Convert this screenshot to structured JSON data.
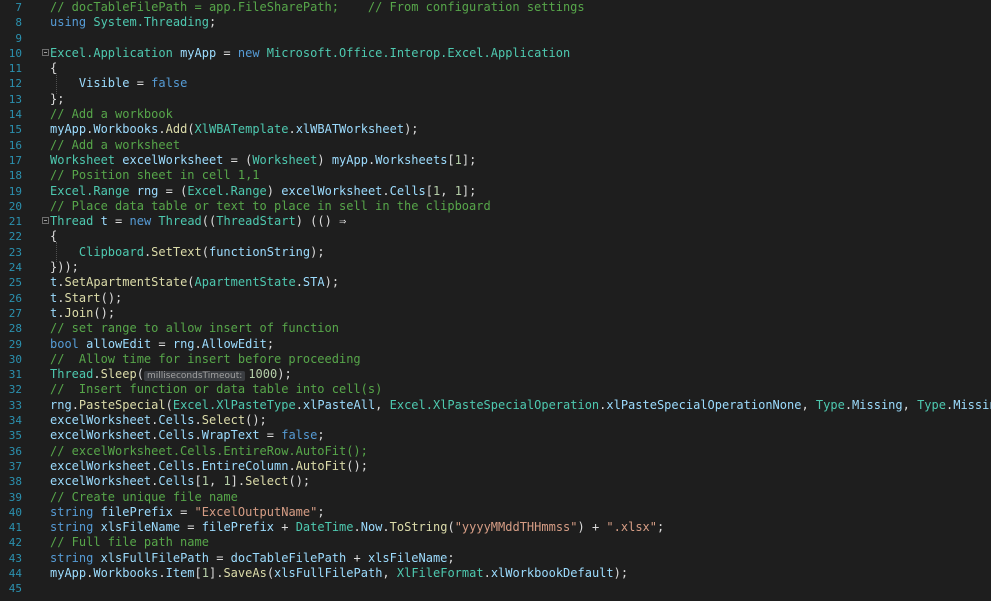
{
  "editor": {
    "lines": [
      {
        "n": "7",
        "tokens": [
          {
            "c": "cm",
            "t": "// docTableFilePath = app.FileSharePath;    // From configuration settings"
          }
        ]
      },
      {
        "n": "8",
        "tokens": [
          {
            "c": "kw",
            "t": "using "
          },
          {
            "c": "ty",
            "t": "System.Threading"
          },
          {
            "c": "",
            "t": ";"
          }
        ]
      },
      {
        "n": "9",
        "tokens": []
      },
      {
        "n": "10",
        "fold": true,
        "tokens": [
          {
            "c": "ty",
            "t": "Excel.Application"
          },
          {
            "c": "",
            "t": " "
          },
          {
            "c": "id",
            "t": "myApp"
          },
          {
            "c": "",
            "t": " = "
          },
          {
            "c": "kw",
            "t": "new "
          },
          {
            "c": "ty",
            "t": "Microsoft.Office.Interop.Excel.Application"
          }
        ]
      },
      {
        "n": "11",
        "tokens": [
          {
            "c": "",
            "t": "{"
          }
        ]
      },
      {
        "n": "12",
        "tokens": [
          {
            "c": "",
            "t": "    "
          },
          {
            "c": "id",
            "t": "Visible"
          },
          {
            "c": "",
            "t": " = "
          },
          {
            "c": "kw",
            "t": "false"
          }
        ]
      },
      {
        "n": "13",
        "tokens": [
          {
            "c": "",
            "t": "};"
          }
        ]
      },
      {
        "n": "14",
        "tokens": [
          {
            "c": "cm",
            "t": "// Add a workbook"
          }
        ]
      },
      {
        "n": "15",
        "tokens": [
          {
            "c": "id",
            "t": "myApp"
          },
          {
            "c": "",
            "t": "."
          },
          {
            "c": "id",
            "t": "Workbooks"
          },
          {
            "c": "",
            "t": "."
          },
          {
            "c": "fn",
            "t": "Add"
          },
          {
            "c": "",
            "t": "("
          },
          {
            "c": "ty",
            "t": "XlWBATemplate"
          },
          {
            "c": "",
            "t": "."
          },
          {
            "c": "id",
            "t": "xlWBATWorksheet"
          },
          {
            "c": "",
            "t": ");"
          }
        ]
      },
      {
        "n": "16",
        "tokens": [
          {
            "c": "cm",
            "t": "// Add a worksheet"
          }
        ]
      },
      {
        "n": "17",
        "tokens": [
          {
            "c": "ty",
            "t": "Worksheet"
          },
          {
            "c": "",
            "t": " "
          },
          {
            "c": "id",
            "t": "excelWorksheet"
          },
          {
            "c": "",
            "t": " = ("
          },
          {
            "c": "ty",
            "t": "Worksheet"
          },
          {
            "c": "",
            "t": ") "
          },
          {
            "c": "id",
            "t": "myApp"
          },
          {
            "c": "",
            "t": "."
          },
          {
            "c": "id",
            "t": "Worksheets"
          },
          {
            "c": "",
            "t": "["
          },
          {
            "c": "nm",
            "t": "1"
          },
          {
            "c": "",
            "t": "];"
          }
        ]
      },
      {
        "n": "18",
        "tokens": [
          {
            "c": "cm",
            "t": "// Position sheet in cell 1,1"
          }
        ]
      },
      {
        "n": "19",
        "tokens": [
          {
            "c": "ty",
            "t": "Excel.Range"
          },
          {
            "c": "",
            "t": " "
          },
          {
            "c": "id",
            "t": "rng"
          },
          {
            "c": "",
            "t": " = ("
          },
          {
            "c": "ty",
            "t": "Excel.Range"
          },
          {
            "c": "",
            "t": ") "
          },
          {
            "c": "id",
            "t": "excelWorksheet"
          },
          {
            "c": "",
            "t": "."
          },
          {
            "c": "id",
            "t": "Cells"
          },
          {
            "c": "",
            "t": "["
          },
          {
            "c": "nm",
            "t": "1"
          },
          {
            "c": "",
            "t": ", "
          },
          {
            "c": "nm",
            "t": "1"
          },
          {
            "c": "",
            "t": "];"
          }
        ]
      },
      {
        "n": "20",
        "tokens": [
          {
            "c": "cm",
            "t": "// Place data table or text to place in sell in the clipboard"
          }
        ]
      },
      {
        "n": "21",
        "fold": true,
        "tokens": [
          {
            "c": "ty",
            "t": "Thread"
          },
          {
            "c": "",
            "t": " "
          },
          {
            "c": "id",
            "t": "t"
          },
          {
            "c": "",
            "t": " = "
          },
          {
            "c": "kw",
            "t": "new "
          },
          {
            "c": "ty",
            "t": "Thread"
          },
          {
            "c": "",
            "t": "(("
          },
          {
            "c": "ty",
            "t": "ThreadStart"
          },
          {
            "c": "",
            "t": ") (() ⇒"
          }
        ]
      },
      {
        "n": "22",
        "tokens": [
          {
            "c": "",
            "t": "{"
          }
        ]
      },
      {
        "n": "23",
        "tokens": [
          {
            "c": "",
            "t": "    "
          },
          {
            "c": "ty",
            "t": "Clipboard"
          },
          {
            "c": "",
            "t": "."
          },
          {
            "c": "fn",
            "t": "SetText"
          },
          {
            "c": "",
            "t": "("
          },
          {
            "c": "id",
            "t": "functionString"
          },
          {
            "c": "",
            "t": ");"
          }
        ]
      },
      {
        "n": "24",
        "tokens": [
          {
            "c": "",
            "t": "}));"
          }
        ]
      },
      {
        "n": "25",
        "tokens": [
          {
            "c": "id",
            "t": "t"
          },
          {
            "c": "",
            "t": "."
          },
          {
            "c": "fn",
            "t": "SetApartmentState"
          },
          {
            "c": "",
            "t": "("
          },
          {
            "c": "ty",
            "t": "ApartmentState"
          },
          {
            "c": "",
            "t": "."
          },
          {
            "c": "id",
            "t": "STA"
          },
          {
            "c": "",
            "t": ");"
          }
        ]
      },
      {
        "n": "26",
        "tokens": [
          {
            "c": "id",
            "t": "t"
          },
          {
            "c": "",
            "t": "."
          },
          {
            "c": "fn",
            "t": "Start"
          },
          {
            "c": "",
            "t": "();"
          }
        ]
      },
      {
        "n": "27",
        "tokens": [
          {
            "c": "id",
            "t": "t"
          },
          {
            "c": "",
            "t": "."
          },
          {
            "c": "fn",
            "t": "Join"
          },
          {
            "c": "",
            "t": "();"
          }
        ]
      },
      {
        "n": "28",
        "tokens": [
          {
            "c": "cm",
            "t": "// set range to allow insert of function"
          }
        ]
      },
      {
        "n": "29",
        "tokens": [
          {
            "c": "kw",
            "t": "bool"
          },
          {
            "c": "",
            "t": " "
          },
          {
            "c": "id",
            "t": "allowEdit"
          },
          {
            "c": "",
            "t": " = "
          },
          {
            "c": "id",
            "t": "rng"
          },
          {
            "c": "",
            "t": "."
          },
          {
            "c": "id",
            "t": "AllowEdit"
          },
          {
            "c": "",
            "t": ";"
          }
        ]
      },
      {
        "n": "30",
        "tokens": [
          {
            "c": "cm",
            "t": "//  Allow time for insert before proceeding"
          }
        ]
      },
      {
        "n": "31",
        "tokens": [
          {
            "c": "ty",
            "t": "Thread"
          },
          {
            "c": "",
            "t": "."
          },
          {
            "c": "fn",
            "t": "Sleep"
          },
          {
            "c": "",
            "t": "("
          },
          {
            "c": "hint",
            "t": "millisecondsTimeout:"
          },
          {
            "c": "nm",
            "t": "1000"
          },
          {
            "c": "",
            "t": ");"
          }
        ]
      },
      {
        "n": "32",
        "tokens": [
          {
            "c": "cm",
            "t": "//  Insert function or data table into cell(s)"
          }
        ]
      },
      {
        "n": "33",
        "tokens": [
          {
            "c": "id",
            "t": "rng"
          },
          {
            "c": "",
            "t": "."
          },
          {
            "c": "fn",
            "t": "PasteSpecial"
          },
          {
            "c": "",
            "t": "("
          },
          {
            "c": "ty",
            "t": "Excel.XlPasteType"
          },
          {
            "c": "",
            "t": "."
          },
          {
            "c": "id",
            "t": "xlPasteAll"
          },
          {
            "c": "",
            "t": ", "
          },
          {
            "c": "ty",
            "t": "Excel.XlPasteSpecialOperation"
          },
          {
            "c": "",
            "t": "."
          },
          {
            "c": "id",
            "t": "xlPasteSpecialOperationNone"
          },
          {
            "c": "",
            "t": ", "
          },
          {
            "c": "ty",
            "t": "Type"
          },
          {
            "c": "",
            "t": "."
          },
          {
            "c": "id",
            "t": "Missing"
          },
          {
            "c": "",
            "t": ", "
          },
          {
            "c": "ty",
            "t": "Type"
          },
          {
            "c": "",
            "t": "."
          },
          {
            "c": "id",
            "t": "Missing"
          },
          {
            "c": "",
            "t": ");"
          }
        ]
      },
      {
        "n": "34",
        "tokens": [
          {
            "c": "id",
            "t": "excelWorksheet"
          },
          {
            "c": "",
            "t": "."
          },
          {
            "c": "id",
            "t": "Cells"
          },
          {
            "c": "",
            "t": "."
          },
          {
            "c": "fn",
            "t": "Select"
          },
          {
            "c": "",
            "t": "();"
          }
        ]
      },
      {
        "n": "35",
        "tokens": [
          {
            "c": "id",
            "t": "excelWorksheet"
          },
          {
            "c": "",
            "t": "."
          },
          {
            "c": "id",
            "t": "Cells"
          },
          {
            "c": "",
            "t": "."
          },
          {
            "c": "id",
            "t": "WrapText"
          },
          {
            "c": "",
            "t": " = "
          },
          {
            "c": "kw",
            "t": "false"
          },
          {
            "c": "",
            "t": ";"
          }
        ]
      },
      {
        "n": "36",
        "tokens": [
          {
            "c": "cm",
            "t": "// excelWorksheet.Cells.EntireRow.AutoFit();"
          }
        ]
      },
      {
        "n": "37",
        "tokens": [
          {
            "c": "id",
            "t": "excelWorksheet"
          },
          {
            "c": "",
            "t": "."
          },
          {
            "c": "id",
            "t": "Cells"
          },
          {
            "c": "",
            "t": "."
          },
          {
            "c": "id",
            "t": "EntireColumn"
          },
          {
            "c": "",
            "t": "."
          },
          {
            "c": "fn",
            "t": "AutoFit"
          },
          {
            "c": "",
            "t": "();"
          }
        ]
      },
      {
        "n": "38",
        "tokens": [
          {
            "c": "id",
            "t": "excelWorksheet"
          },
          {
            "c": "",
            "t": "."
          },
          {
            "c": "id",
            "t": "Cells"
          },
          {
            "c": "",
            "t": "["
          },
          {
            "c": "nm",
            "t": "1"
          },
          {
            "c": "",
            "t": ", "
          },
          {
            "c": "nm",
            "t": "1"
          },
          {
            "c": "",
            "t": "]."
          },
          {
            "c": "fn",
            "t": "Select"
          },
          {
            "c": "",
            "t": "();"
          }
        ]
      },
      {
        "n": "39",
        "tokens": [
          {
            "c": "cm",
            "t": "// Create unique file name"
          }
        ]
      },
      {
        "n": "40",
        "tokens": [
          {
            "c": "kw",
            "t": "string"
          },
          {
            "c": "",
            "t": " "
          },
          {
            "c": "id",
            "t": "filePrefix"
          },
          {
            "c": "",
            "t": " = "
          },
          {
            "c": "st",
            "t": "\"ExcelOutputName\""
          },
          {
            "c": "",
            "t": ";"
          }
        ]
      },
      {
        "n": "41",
        "tokens": [
          {
            "c": "kw",
            "t": "string"
          },
          {
            "c": "",
            "t": " "
          },
          {
            "c": "id",
            "t": "xlsFileName"
          },
          {
            "c": "",
            "t": " = "
          },
          {
            "c": "id",
            "t": "filePrefix"
          },
          {
            "c": "",
            "t": " + "
          },
          {
            "c": "ty",
            "t": "DateTime"
          },
          {
            "c": "",
            "t": "."
          },
          {
            "c": "id",
            "t": "Now"
          },
          {
            "c": "",
            "t": "."
          },
          {
            "c": "fn",
            "t": "ToString"
          },
          {
            "c": "",
            "t": "("
          },
          {
            "c": "st",
            "t": "\"yyyyMMddTHHmmss\""
          },
          {
            "c": "",
            "t": ") + "
          },
          {
            "c": "st",
            "t": "\".xlsx\""
          },
          {
            "c": "",
            "t": ";"
          }
        ]
      },
      {
        "n": "42",
        "tokens": [
          {
            "c": "cm",
            "t": "// Full file path name"
          }
        ]
      },
      {
        "n": "43",
        "tokens": [
          {
            "c": "kw",
            "t": "string"
          },
          {
            "c": "",
            "t": " "
          },
          {
            "c": "id",
            "t": "xlsFullFilePath"
          },
          {
            "c": "",
            "t": " = "
          },
          {
            "c": "id",
            "t": "docTableFilePath"
          },
          {
            "c": "",
            "t": " + "
          },
          {
            "c": "id",
            "t": "xlsFileName"
          },
          {
            "c": "",
            "t": ";"
          }
        ]
      },
      {
        "n": "44",
        "tokens": [
          {
            "c": "id",
            "t": "myApp"
          },
          {
            "c": "",
            "t": "."
          },
          {
            "c": "id",
            "t": "Workbooks"
          },
          {
            "c": "",
            "t": "."
          },
          {
            "c": "id",
            "t": "Item"
          },
          {
            "c": "",
            "t": "["
          },
          {
            "c": "nm",
            "t": "1"
          },
          {
            "c": "",
            "t": "]."
          },
          {
            "c": "fn",
            "t": "SaveAs"
          },
          {
            "c": "",
            "t": "("
          },
          {
            "c": "id",
            "t": "xlsFullFilePath"
          },
          {
            "c": "",
            "t": ", "
          },
          {
            "c": "ty",
            "t": "XlFileFormat"
          },
          {
            "c": "",
            "t": "."
          },
          {
            "c": "id",
            "t": "xlWorkbookDefault"
          },
          {
            "c": "",
            "t": ");"
          }
        ]
      },
      {
        "n": "45",
        "tokens": []
      }
    ]
  },
  "colors": {
    "background": "#1e1e1e",
    "comment": "#57a64a",
    "keyword": "#569cd6",
    "type": "#4ec9b0",
    "method": "#dcdcaa",
    "number": "#b5cea8",
    "string": "#d69d85",
    "identifier": "#9cdcfe",
    "line_number": "#2b91af"
  }
}
